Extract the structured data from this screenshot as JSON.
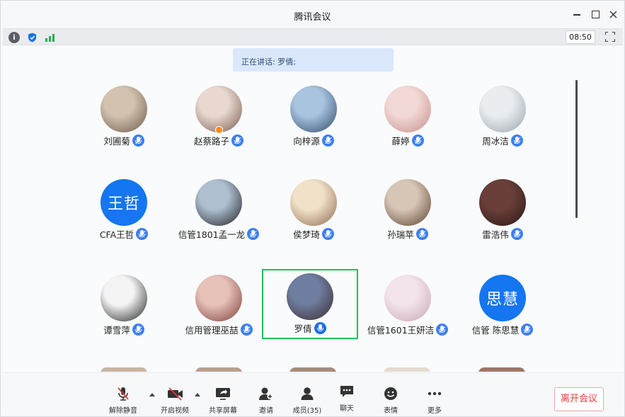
{
  "window": {
    "title": "腾讯会议"
  },
  "infobar": {
    "time": "08:50"
  },
  "speaking_banner": "正在讲话: 罗倩;",
  "participants": [
    {
      "name": "刘圃菊",
      "avatar": "photo",
      "colors": [
        "#d4c2b0",
        "#6b5a4a"
      ]
    },
    {
      "name": "赵蔡路子",
      "avatar": "photo",
      "colors": [
        "#e8d8cf",
        "#7a5a4e"
      ],
      "host": true
    },
    {
      "name": "向梓源",
      "avatar": "photo",
      "colors": [
        "#a8c4de",
        "#2f4a6b"
      ]
    },
    {
      "name": "薛婷",
      "avatar": "photo",
      "colors": [
        "#f2d9d6",
        "#c78e8a"
      ]
    },
    {
      "name": "周冰洁",
      "avatar": "photo",
      "colors": [
        "#e9edf0",
        "#9aa4ac"
      ]
    },
    {
      "name": "CFA王哲",
      "avatar": "text",
      "text": "王哲"
    },
    {
      "name": "信管1801孟一龙",
      "avatar": "photo",
      "colors": [
        "#aebfcf",
        "#1b1d22"
      ]
    },
    {
      "name": "侯梦琦",
      "avatar": "photo",
      "colors": [
        "#f2e1c9",
        "#8c6a4c"
      ]
    },
    {
      "name": "孙瑞苹",
      "avatar": "photo",
      "colors": [
        "#d7c6b6",
        "#5a3f2e"
      ]
    },
    {
      "name": "雷浩伟",
      "avatar": "photo",
      "colors": [
        "#6a3f3a",
        "#2b1714"
      ]
    },
    {
      "name": "谭雪萍",
      "avatar": "photo",
      "colors": [
        "#f4f4f4",
        "#1e1e1e"
      ]
    },
    {
      "name": "信用管理巫喆",
      "avatar": "photo",
      "colors": [
        "#e6c1b8",
        "#7b3f3a"
      ]
    },
    {
      "name": "罗倩",
      "avatar": "photo",
      "colors": [
        "#6f7ea0",
        "#3a2a2f"
      ],
      "active": true
    },
    {
      "name": "信管1601王妍洁",
      "avatar": "photo",
      "colors": [
        "#f2e4ea",
        "#c9a6b3"
      ]
    },
    {
      "name": "信管 陈思慧",
      "avatar": "text",
      "text": "思慧"
    }
  ],
  "toolbar": {
    "unmute": "解除静音",
    "video": "开启视频",
    "share": "共享屏幕",
    "invite": "邀请",
    "members": "成员(35)",
    "chat": "聊天",
    "emoji": "表情",
    "more": "更多",
    "leave": "离开会议"
  },
  "colors": {
    "accent": "#1476f0",
    "active_border": "#1fc05a",
    "leave": "#e5393a",
    "signal": "#22b14c"
  }
}
